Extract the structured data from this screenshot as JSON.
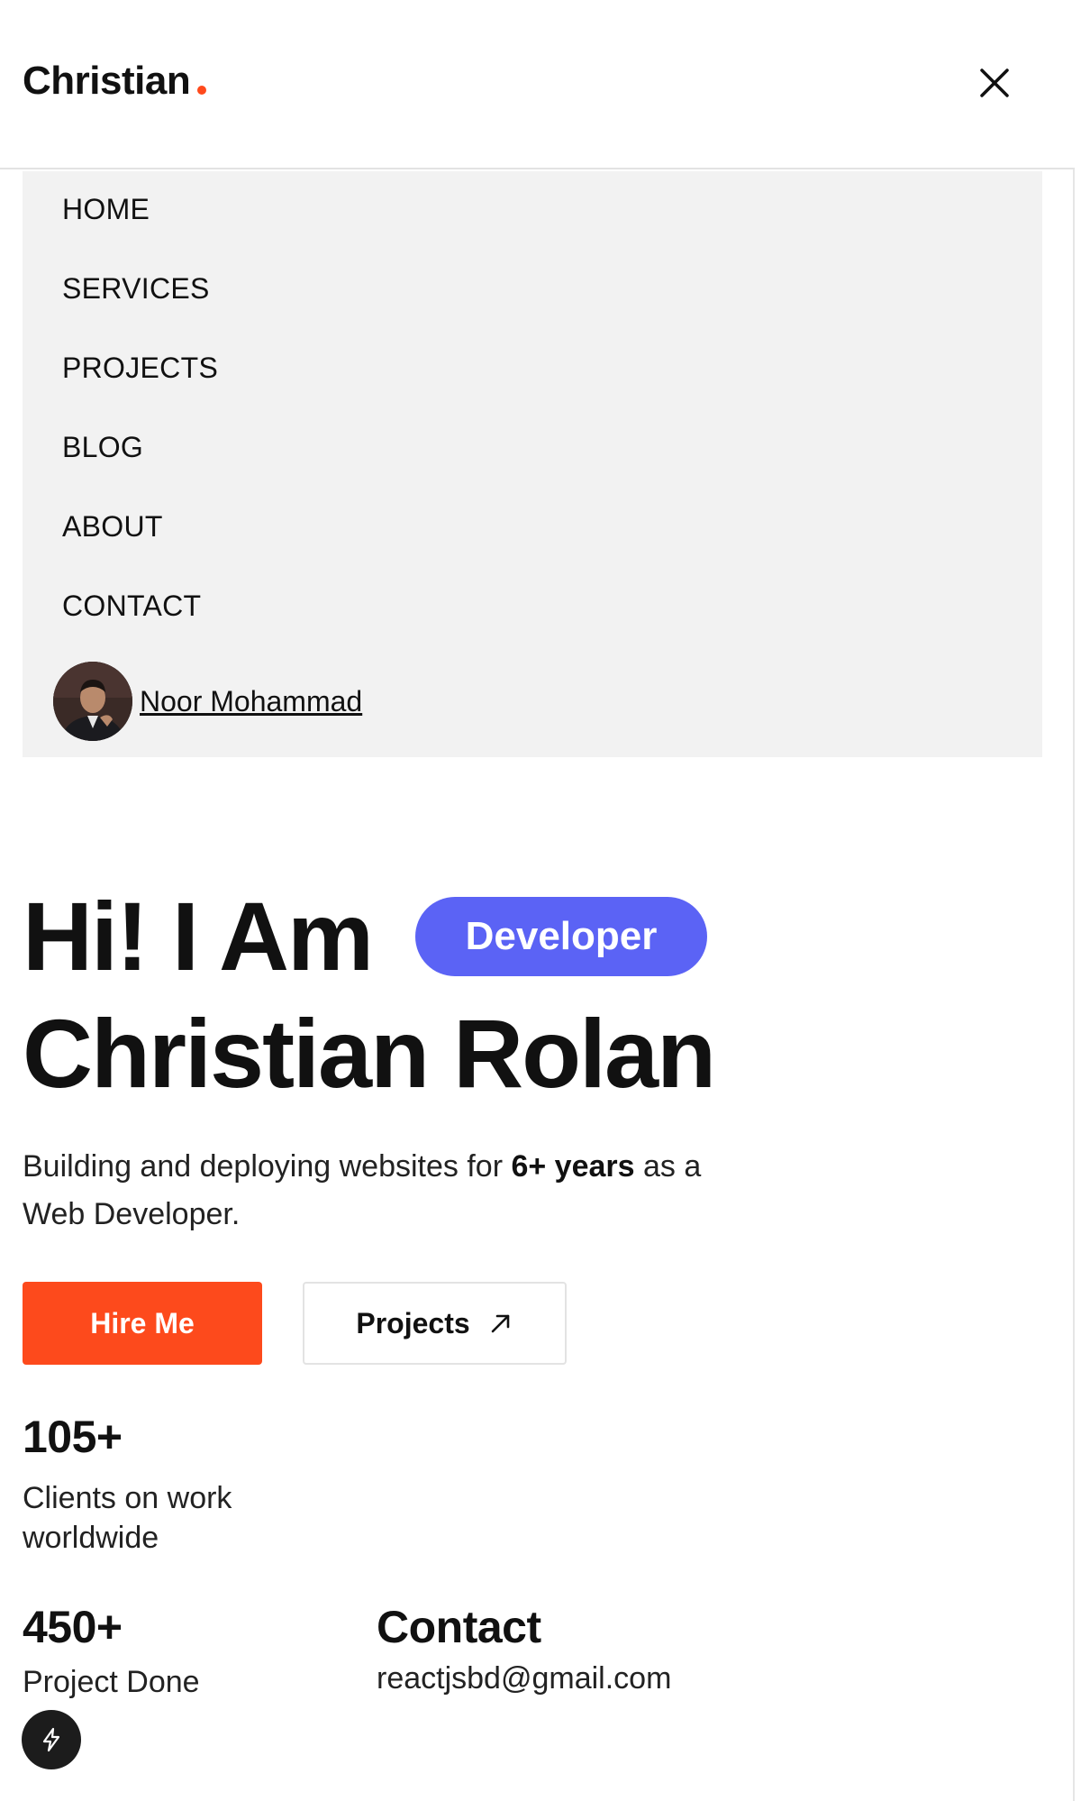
{
  "header": {
    "brand": "Christian",
    "close_icon": "close-icon",
    "accent_color": "#ff4a1c"
  },
  "menu": {
    "items": [
      {
        "label": "HOME"
      },
      {
        "label": "SERVICES"
      },
      {
        "label": "PROJECTS"
      },
      {
        "label": "BLOG"
      },
      {
        "label": "ABOUT"
      },
      {
        "label": "CONTACT"
      }
    ],
    "user": {
      "name": "Noor Mohammad"
    }
  },
  "hero": {
    "line1": "Hi! I Am",
    "badge": "Developer",
    "badge_color": "#5b63f5",
    "line2": "Christian Rolan",
    "desc_part1": "Building and deploying websites for ",
    "desc_bold": "6+ years",
    "desc_part2": " as a Web Developer.",
    "hire_button": "Hire Me",
    "hire_color": "#fd4a1c",
    "projects_button": "Projects",
    "projects_icon": "arrow-up-right-icon"
  },
  "stats": {
    "clients_value": "105+",
    "clients_label": "Clients on work worldwide",
    "projects_value": "450+",
    "projects_label": "Project Done",
    "contact_title": "Contact",
    "contact_email": "reactjsbd@gmail.com"
  },
  "fab": {
    "icon": "lightning-icon"
  }
}
